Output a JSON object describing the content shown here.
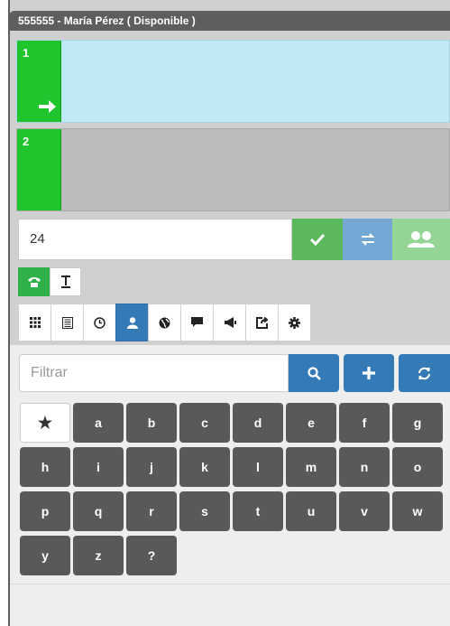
{
  "titlebar": {
    "text": "555555 - María Pérez ( Disponible )"
  },
  "lines": [
    {
      "number": "1"
    },
    {
      "number": "2"
    }
  ],
  "dial": {
    "value": "24"
  },
  "filter": {
    "placeholder": "Filtrar"
  },
  "keys": [
    "★",
    "a",
    "b",
    "c",
    "d",
    "e",
    "f",
    "g",
    "h",
    "i",
    "j",
    "k",
    "l",
    "m",
    "n",
    "o",
    "p",
    "q",
    "r",
    "s",
    "t",
    "u",
    "v",
    "w",
    "y",
    "z",
    "?"
  ],
  "colors": {
    "green": "#20c42c",
    "accept": "#5cb85c",
    "transfer": "#74a7d3",
    "conference": "#94d494",
    "primary": "#337ab7",
    "key": "#595959"
  },
  "icons": {
    "mode": [
      "phone-icon",
      "text-icon"
    ],
    "tabs": [
      "dialpad-icon",
      "list-icon",
      "clock-icon",
      "contact-icon",
      "globe-icon",
      "chat-icon",
      "megaphone-icon",
      "share-icon",
      "gear-icon"
    ],
    "active_tab": "contact-icon"
  }
}
